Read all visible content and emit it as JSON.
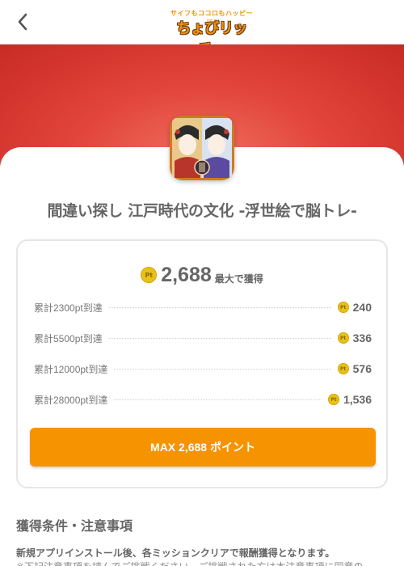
{
  "header": {
    "back_icon": "chevron-left-icon",
    "logo_tagline": "サイフもココロもハッピーに!",
    "logo_text": "ちょびリッチ。",
    "logo_color": "#f29300"
  },
  "hero": {
    "color": "#e2453b",
    "app_icon": "ukiyoe-app-icon"
  },
  "app": {
    "title": "間違い探し 江戸時代の文化 -浮世絵で脳トレ-"
  },
  "reward": {
    "total_points": "2,688",
    "total_suffix": "最大で獲得",
    "point_badge_text": "Pt",
    "steps": [
      {
        "label": "累計2300pt到達",
        "points": "240"
      },
      {
        "label": "累計5500pt到達",
        "points": "336"
      },
      {
        "label": "累計12000pt到達",
        "points": "576"
      },
      {
        "label": "累計28000pt到達",
        "points": "1,536"
      }
    ],
    "button_label": "MAX 2,688 ポイント",
    "button_color": "#f59400"
  },
  "conditions": {
    "heading": "獲得条件・注意事項",
    "line1": "新規アプリインストール後、各ミッションクリアで報酬獲得となります。",
    "line2": "※下記注意事項を読んでご挑戦ください。ご挑戦された方は本注意事項に同意の"
  }
}
